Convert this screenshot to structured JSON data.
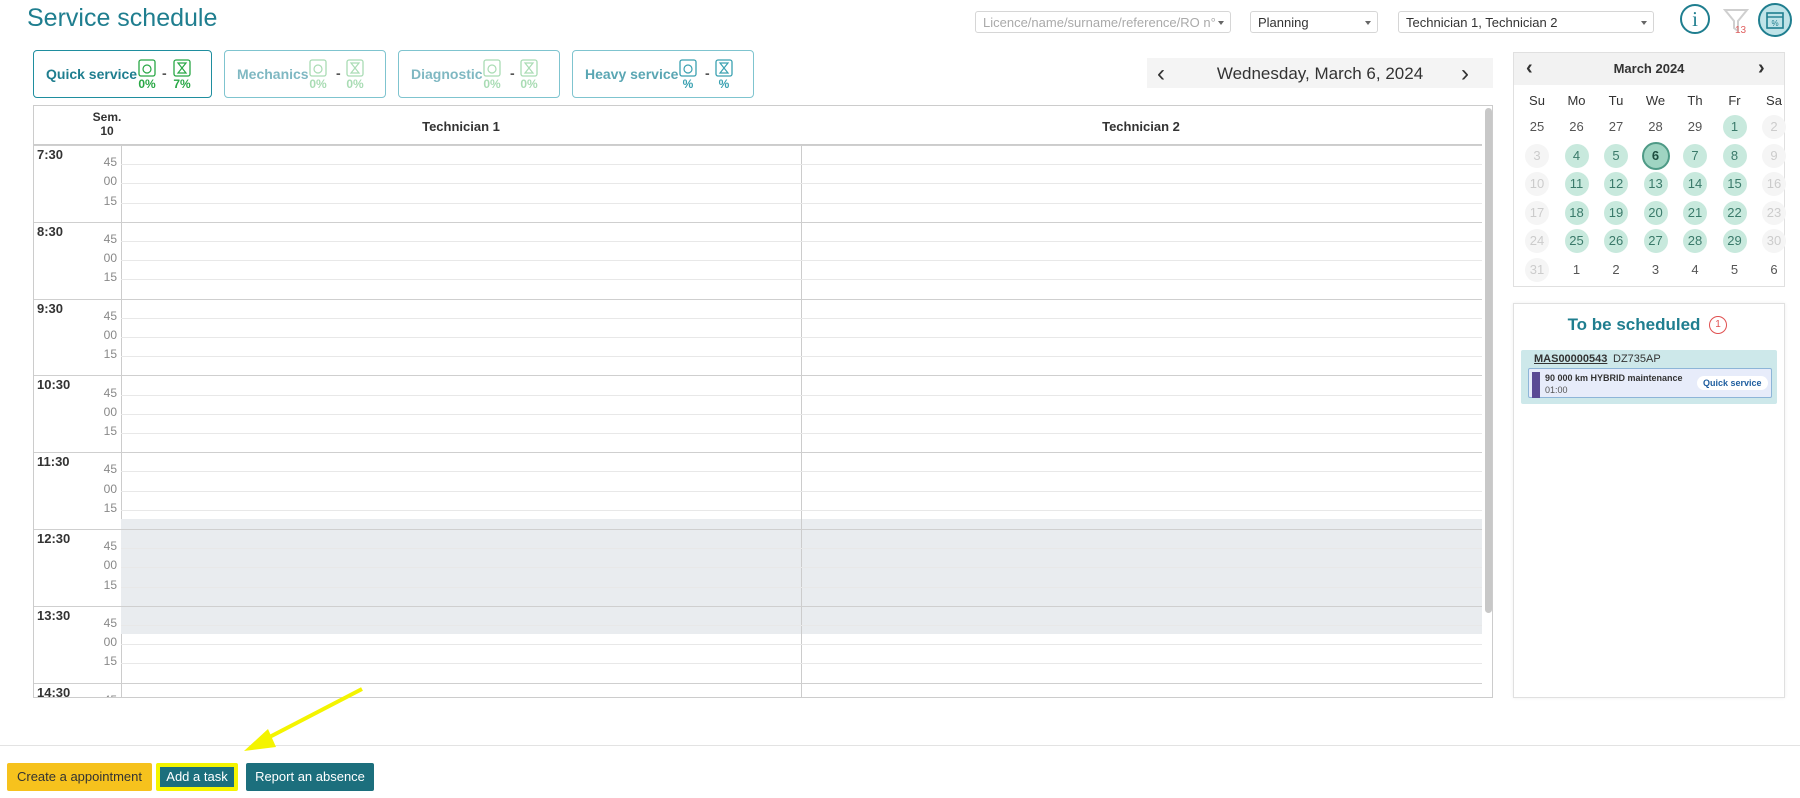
{
  "page_title": "Service schedule",
  "toolbar": {
    "search_placeholder": "Licence/name/surname/reference/RO n°",
    "view_selected": "Planning",
    "technicians_selected": "Technician 1, Technician 2",
    "filter_count": "13"
  },
  "service_filters": [
    {
      "label": "Quick service",
      "pct_a": "0%",
      "pct_b": "7%",
      "active": true
    },
    {
      "label": "Mechanics",
      "pct_a": "0%",
      "pct_b": "0%",
      "active": false
    },
    {
      "label": "Diagnostic",
      "pct_a": "0%",
      "pct_b": "0%",
      "active": false
    },
    {
      "label": "Heavy service",
      "pct_a": "%",
      "pct_b": "%",
      "active": false
    }
  ],
  "date_nav": {
    "current_date": "Wednesday, March 6, 2024",
    "prev": "‹",
    "next": "›"
  },
  "schedule": {
    "week_label": "Sem.",
    "week_number": "10",
    "columns": [
      "Technician 1",
      "Technician 2"
    ],
    "hours": [
      "7:30",
      "8:30",
      "9:30",
      "10:30",
      "11:30",
      "12:30",
      "13:30",
      "14:30"
    ],
    "minute_marks": [
      "45",
      "00",
      "15"
    ]
  },
  "mini_calendar": {
    "title": "March 2024",
    "prev": "‹",
    "next": "›",
    "weekdays": [
      "Su",
      "Mo",
      "Tu",
      "We",
      "Th",
      "Fr",
      "Sa"
    ],
    "weeks": [
      [
        {
          "d": "25",
          "s": "plain"
        },
        {
          "d": "26",
          "s": "plain"
        },
        {
          "d": "27",
          "s": "plain"
        },
        {
          "d": "28",
          "s": "plain"
        },
        {
          "d": "29",
          "s": "plain"
        },
        {
          "d": "1",
          "s": "avail"
        },
        {
          "d": "2",
          "s": "closed"
        }
      ],
      [
        {
          "d": "3",
          "s": "closed"
        },
        {
          "d": "4",
          "s": "avail"
        },
        {
          "d": "5",
          "s": "avail"
        },
        {
          "d": "6",
          "s": "today"
        },
        {
          "d": "7",
          "s": "avail"
        },
        {
          "d": "8",
          "s": "avail"
        },
        {
          "d": "9",
          "s": "closed"
        }
      ],
      [
        {
          "d": "10",
          "s": "closed"
        },
        {
          "d": "11",
          "s": "avail"
        },
        {
          "d": "12",
          "s": "avail"
        },
        {
          "d": "13",
          "s": "avail"
        },
        {
          "d": "14",
          "s": "avail"
        },
        {
          "d": "15",
          "s": "avail"
        },
        {
          "d": "16",
          "s": "closed"
        }
      ],
      [
        {
          "d": "17",
          "s": "closed"
        },
        {
          "d": "18",
          "s": "avail"
        },
        {
          "d": "19",
          "s": "avail"
        },
        {
          "d": "20",
          "s": "avail"
        },
        {
          "d": "21",
          "s": "avail"
        },
        {
          "d": "22",
          "s": "avail"
        },
        {
          "d": "23",
          "s": "closed"
        }
      ],
      [
        {
          "d": "24",
          "s": "closed"
        },
        {
          "d": "25",
          "s": "avail"
        },
        {
          "d": "26",
          "s": "avail"
        },
        {
          "d": "27",
          "s": "avail"
        },
        {
          "d": "28",
          "s": "avail"
        },
        {
          "d": "29",
          "s": "avail"
        },
        {
          "d": "30",
          "s": "closed"
        }
      ],
      [
        {
          "d": "31",
          "s": "closed"
        },
        {
          "d": "1",
          "s": "plain"
        },
        {
          "d": "2",
          "s": "plain"
        },
        {
          "d": "3",
          "s": "plain"
        },
        {
          "d": "4",
          "s": "plain"
        },
        {
          "d": "5",
          "s": "plain"
        },
        {
          "d": "6",
          "s": "plain"
        }
      ]
    ]
  },
  "to_be_scheduled": {
    "title": "To be scheduled",
    "count": "1",
    "jobs": [
      {
        "ro": "MAS00000543",
        "plate": "DZ735AP",
        "description": "90 000 km HYBRID maintenance",
        "duration": "01:00",
        "service": "Quick service"
      }
    ]
  },
  "actions": {
    "create_appointment": "Create a appointment",
    "add_task": "Add a task",
    "report_absence": "Report an absence"
  },
  "colors": {
    "accent": "#1f7e8f",
    "button_primary": "#1c6f7d",
    "button_warning": "#f6c21d",
    "highlight": "#f4f400",
    "available_day": "#c8e9dd"
  }
}
